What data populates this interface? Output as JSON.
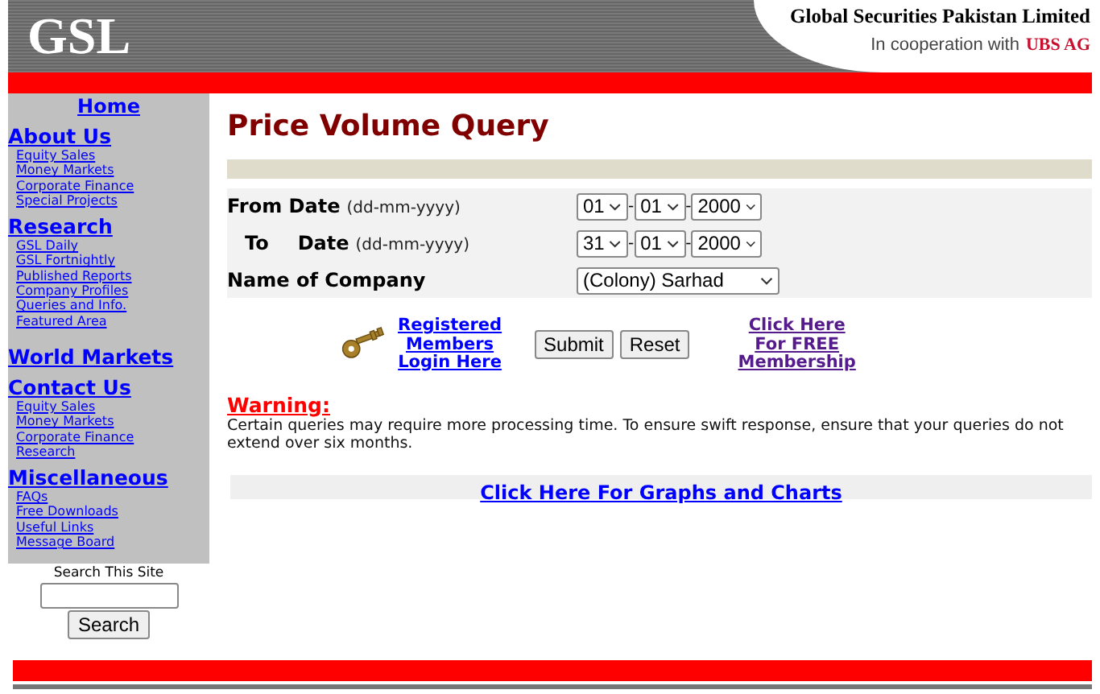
{
  "header": {
    "logo": "GSL",
    "company": "Global Securities Pakistan Limited",
    "tagline": "In cooperation with",
    "partner": "UBS AG"
  },
  "sidebar": {
    "home": "Home",
    "sections": [
      {
        "title": "About Us",
        "items": [
          "Equity Sales",
          "Money Markets",
          "Corporate Finance",
          "Special Projects"
        ]
      },
      {
        "title": "Research",
        "items": [
          "GSL Daily",
          "GSL Fortnightly",
          "Published Reports",
          "Company Profiles",
          "Queries and Info.",
          "Featured Area"
        ]
      },
      {
        "title": "World Markets"
      },
      {
        "title": "Contact Us",
        "items": [
          "Equity Sales",
          "Money Markets",
          "Corporate Finance",
          "Research"
        ]
      },
      {
        "title": "Miscellaneous",
        "items": [
          "FAQs",
          "Free Downloads",
          "Useful Links",
          "Message Board"
        ]
      }
    ]
  },
  "search": {
    "label": "Search This Site",
    "button": "Search"
  },
  "page_title": "Price Volume Query",
  "form": {
    "rows": [
      {
        "kind": "date",
        "label": "From Date",
        "hint": "(dd-mm-yyyy)",
        "values": [
          "01",
          "01",
          "2000"
        ],
        "separator": "-"
      },
      {
        "kind": "date",
        "prefix": "To",
        "label": "Date",
        "hint": "(dd-mm-yyyy)",
        "values": [
          "31",
          "01",
          "2000"
        ],
        "separator": "-"
      },
      {
        "kind": "select",
        "label": "Name of Company",
        "value": "(Colony) Sarhad"
      }
    ]
  },
  "actions": {
    "login_link": [
      "Registered",
      "Members",
      "Login Here"
    ],
    "buttons": [
      "Submit",
      "Reset"
    ],
    "membership_link": [
      "Click Here",
      "For FREE",
      "Membership"
    ]
  },
  "warning": {
    "title": "Warning:",
    "text": "Certain queries may require more processing time. To ensure swift response, ensure that your queries do not extend over six months."
  },
  "graphs_link": "Click Here For Graphs and Charts"
}
